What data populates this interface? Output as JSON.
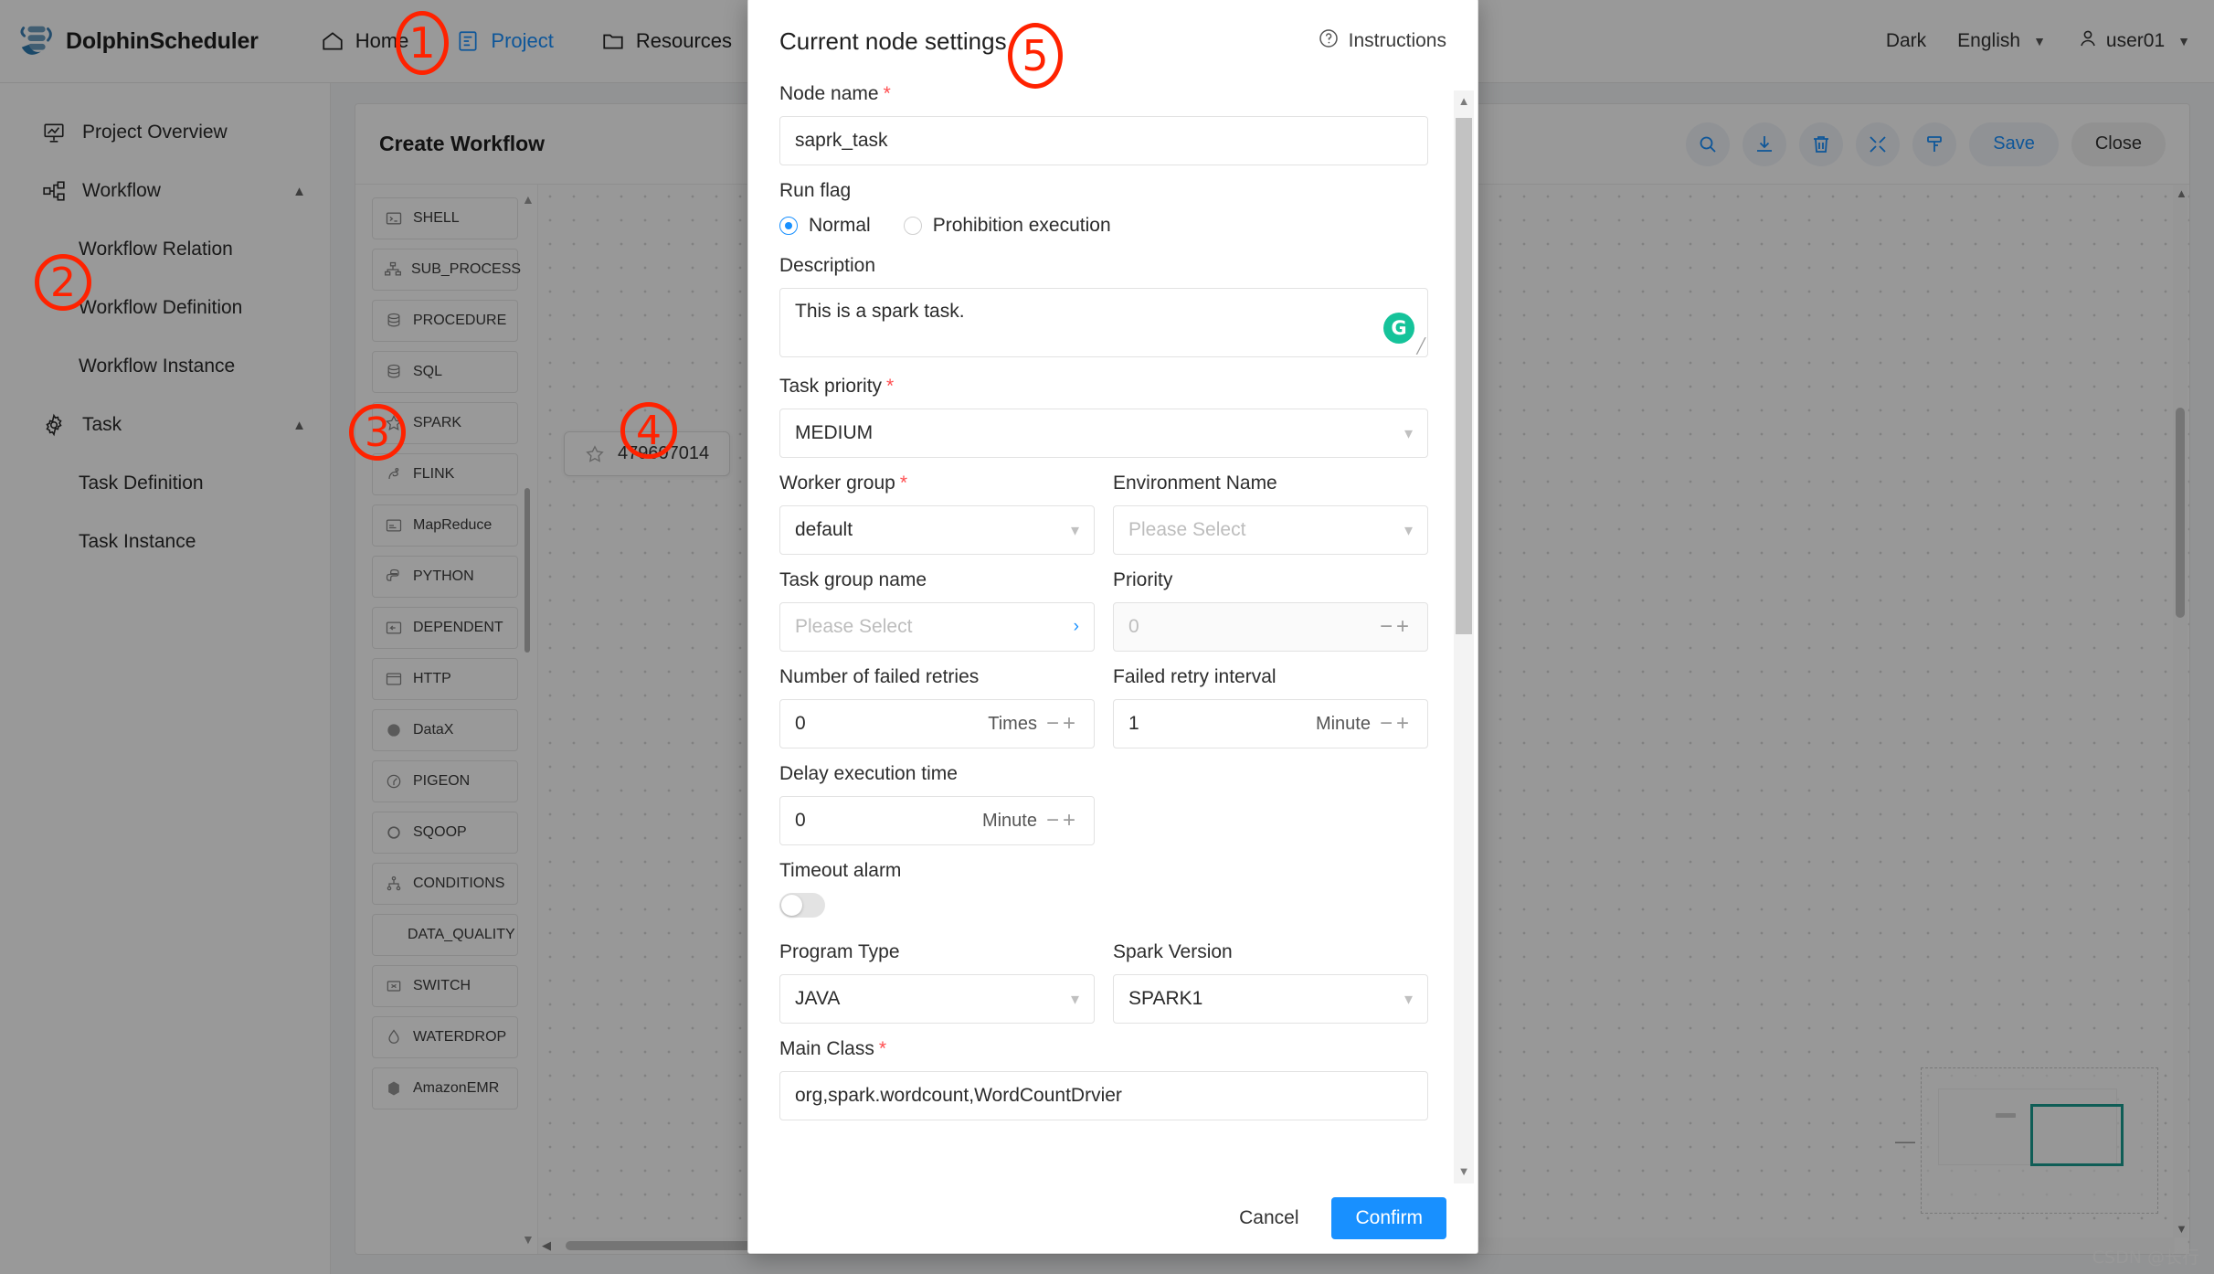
{
  "app": {
    "brand": "DolphinScheduler",
    "nav": [
      {
        "label": "Home",
        "icon": "home-icon",
        "active": false
      },
      {
        "label": "Project",
        "icon": "project-icon",
        "active": true
      },
      {
        "label": "Resources",
        "icon": "folder-icon",
        "active": false
      },
      {
        "label": "",
        "icon": "datasource-icon",
        "active": false
      }
    ],
    "theme_label": "Dark",
    "language_label": "English",
    "user_label": "user01"
  },
  "sidebar": {
    "items": [
      {
        "label": "Project Overview",
        "icon": "dashboard-icon",
        "type": "item",
        "expandable": false
      },
      {
        "label": "Workflow",
        "icon": "workflow-icon",
        "type": "item",
        "expandable": true
      },
      {
        "label": "Workflow Relation",
        "type": "sub"
      },
      {
        "label": "Workflow Definition",
        "type": "sub"
      },
      {
        "label": "Workflow Instance",
        "type": "sub"
      },
      {
        "label": "Task",
        "icon": "gear-icon",
        "type": "item",
        "expandable": true
      },
      {
        "label": "Task Definition",
        "type": "sub"
      },
      {
        "label": "Task Instance",
        "type": "sub"
      }
    ]
  },
  "panel": {
    "title": "Create Workflow",
    "toolbar": {
      "icons": [
        "search-icon",
        "download-icon",
        "trash-icon",
        "fullscreen-icon",
        "format-icon"
      ],
      "save_label": "Save",
      "close_label": "Close"
    }
  },
  "palette": {
    "items": [
      {
        "label": "SHELL",
        "icon": "shell-icon"
      },
      {
        "label": "SUB_PROCESS",
        "icon": "subprocess-icon"
      },
      {
        "label": "PROCEDURE",
        "icon": "procedure-icon"
      },
      {
        "label": "SQL",
        "icon": "sql-icon"
      },
      {
        "label": "SPARK",
        "icon": "spark-icon"
      },
      {
        "label": "FLINK",
        "icon": "flink-icon"
      },
      {
        "label": "MapReduce",
        "icon": "mapreduce-icon"
      },
      {
        "label": "PYTHON",
        "icon": "python-icon"
      },
      {
        "label": "DEPENDENT",
        "icon": "dependent-icon"
      },
      {
        "label": "HTTP",
        "icon": "http-icon"
      },
      {
        "label": "DataX",
        "icon": "datax-icon"
      },
      {
        "label": "PIGEON",
        "icon": "pigeon-icon"
      },
      {
        "label": "SQOOP",
        "icon": "sqoop-icon"
      },
      {
        "label": "CONDITIONS",
        "icon": "conditions-icon"
      },
      {
        "label": "DATA_QUALITY",
        "icon": ""
      },
      {
        "label": "SWITCH",
        "icon": "switch-icon"
      },
      {
        "label": "WATERDROP",
        "icon": "waterdrop-icon"
      },
      {
        "label": "AmazonEMR",
        "icon": "emr-icon"
      }
    ]
  },
  "canvas": {
    "node_label": "479607014",
    "node_icon": "spark-icon",
    "watermark": "CSDN @长行"
  },
  "modal": {
    "title": "Current node settings",
    "instructions_label": "Instructions",
    "node_name": {
      "label": "Node name",
      "required": true,
      "value": "saprk_task"
    },
    "run_flag": {
      "label": "Run flag",
      "options": [
        {
          "label": "Normal",
          "selected": true
        },
        {
          "label": "Prohibition execution",
          "selected": false
        }
      ]
    },
    "description": {
      "label": "Description",
      "value": "This is a spark task.",
      "assistant_badge": "G"
    },
    "task_priority": {
      "label": "Task priority",
      "required": true,
      "value": "MEDIUM"
    },
    "worker_group": {
      "label": "Worker group",
      "required": true,
      "value": "default"
    },
    "environment_name": {
      "label": "Environment Name",
      "required": false,
      "placeholder": "Please Select"
    },
    "task_group_name": {
      "label": "Task group name",
      "required": false,
      "placeholder": "Please Select"
    },
    "priority": {
      "label": "Priority",
      "required": false,
      "value": "0",
      "disabled": true
    },
    "failed_retries": {
      "label": "Number of failed retries",
      "value": "0",
      "unit": "Times"
    },
    "failed_retry_interval": {
      "label": "Failed retry interval",
      "value": "1",
      "unit": "Minute"
    },
    "delay_execution_time": {
      "label": "Delay execution time",
      "value": "0",
      "unit": "Minute"
    },
    "timeout_alarm": {
      "label": "Timeout alarm",
      "enabled": false
    },
    "program_type": {
      "label": "Program Type",
      "value": "JAVA"
    },
    "spark_version": {
      "label": "Spark Version",
      "value": "SPARK1"
    },
    "main_class": {
      "label": "Main Class",
      "required": true,
      "value": "org,spark.wordcount,WordCountDrvier"
    },
    "cancel_label": "Cancel",
    "confirm_label": "Confirm"
  },
  "annotations": [
    {
      "number": "1"
    },
    {
      "number": "2"
    },
    {
      "number": "3"
    },
    {
      "number": "4"
    },
    {
      "number": "5"
    }
  ],
  "colors": {
    "accent": "#1890ff",
    "required": "#ff4d4f",
    "annotation": "#ff2200",
    "assistant": "#15c39a",
    "minimap_view": "#1a9c8f"
  }
}
